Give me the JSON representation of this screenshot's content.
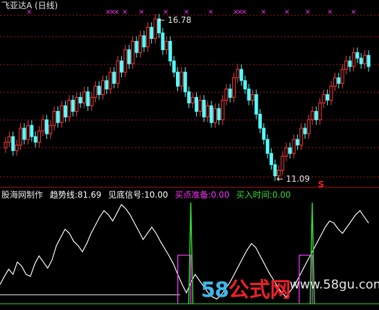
{
  "header": {
    "title": "飞亚达A (日线)"
  },
  "price_panel": {
    "high_label": "16.78",
    "low_label": "11.09",
    "sell_mark": "S",
    "colors": {
      "up": "#ff3c3c",
      "down": "#54ffff",
      "marker": "#ff33ff",
      "grid": "#b01818"
    }
  },
  "indicator": {
    "name": "股海网制作",
    "items": [
      {
        "label": "趋势线:",
        "value": "81.69",
        "color": "#ffffff"
      },
      {
        "label": "见底信号:",
        "value": "10.00",
        "color": "#ffffff"
      },
      {
        "label": "买点准备:",
        "value": "0.00",
        "color": "#ff33ff"
      },
      {
        "label": "买入时间:",
        "value": "0.00",
        "color": "#33dd33"
      }
    ]
  },
  "watermark": {
    "num": "58",
    "cn": "公式网",
    "url": "www.58gu.com"
  },
  "chart_data": {
    "type": "candlestick",
    "price_high": 16.78,
    "price_low": 11.09,
    "closes": [
      12.3,
      12.5,
      12.0,
      12.2,
      12.8,
      12.4,
      12.9,
      12.5,
      12.3,
      12.7,
      13.1,
      12.6,
      12.9,
      13.4,
      13.0,
      13.6,
      13.2,
      13.8,
      13.4,
      13.9,
      13.7,
      14.1,
      13.6,
      13.9,
      14.3,
      14.0,
      14.5,
      14.2,
      14.8,
      14.4,
      15.2,
      14.8,
      15.6,
      15.1,
      15.9,
      15.5,
      16.1,
      15.7,
      16.4,
      16.0,
      16.7,
      16.2,
      15.6,
      15.9,
      15.2,
      14.8,
      14.3,
      14.8,
      14.1,
      13.7,
      13.9,
      13.4,
      13.8,
      13.2,
      13.6,
      13.0,
      13.5,
      13.1,
      13.8,
      14.2,
      13.9,
      14.6,
      14.9,
      14.5,
      14.2,
      13.8,
      14.0,
      13.3,
      12.8,
      12.4,
      11.9,
      11.5,
      11.1,
      11.3,
      11.8,
      12.1,
      11.9,
      12.4,
      12.2,
      12.8,
      12.6,
      13.1,
      13.4,
      13.1,
      13.7,
      14.0,
      13.8,
      14.3,
      14.6,
      14.4,
      14.9,
      15.2,
      15.0,
      15.5,
      15.3,
      15.1,
      15.4,
      15.0
    ],
    "trend_line": [
      20,
      28,
      35,
      30,
      42,
      38,
      30,
      28,
      40,
      48,
      42,
      36,
      44,
      58,
      66,
      74,
      70,
      62,
      58,
      52,
      60,
      70,
      78,
      86,
      92,
      88,
      82,
      90,
      98,
      94,
      88,
      80,
      72,
      64,
      70,
      76,
      70,
      62,
      55,
      48,
      40,
      30,
      20,
      12,
      22,
      30,
      24,
      18,
      12,
      8,
      6,
      10,
      16,
      22,
      30,
      38,
      46,
      54,
      60,
      56,
      48,
      40,
      32,
      25,
      18,
      12,
      8,
      14,
      20,
      28,
      36,
      44,
      52,
      60,
      68,
      76,
      82,
      80,
      74,
      70,
      76,
      82,
      88,
      92,
      86,
      80
    ],
    "buy_time_spikes": [
      44,
      72
    ],
    "buy_prep_boxes": [
      [
        41,
        44
      ],
      [
        69,
        72
      ]
    ]
  }
}
